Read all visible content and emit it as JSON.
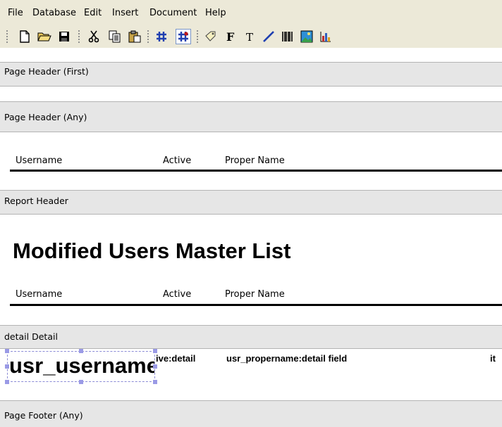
{
  "menu": {
    "items": [
      "File",
      "Database",
      "Edit",
      "Insert",
      "Document",
      "Help"
    ]
  },
  "toolbar": {
    "buttons": [
      {
        "name": "new-document-icon"
      },
      {
        "name": "open-folder-icon"
      },
      {
        "name": "save-icon"
      },
      {
        "name": "cut-icon"
      },
      {
        "name": "copy-icon"
      },
      {
        "name": "paste-icon"
      },
      {
        "name": "grid-icon"
      },
      {
        "name": "snap-to-grid-icon",
        "active": true
      },
      {
        "name": "label-tag-icon"
      },
      {
        "name": "field-icon"
      },
      {
        "name": "text-icon"
      },
      {
        "name": "line-icon"
      },
      {
        "name": "barcode-icon"
      },
      {
        "name": "image-icon"
      },
      {
        "name": "chart-icon"
      }
    ]
  },
  "bands": {
    "page_header_first": {
      "label": "Page Header (First)"
    },
    "page_header_any": {
      "label": "Page Header (Any)",
      "columns": [
        "Username",
        "Active",
        "Proper Name"
      ]
    },
    "report_header": {
      "label": "Report Header",
      "title": "Modified Users Master List",
      "columns": [
        "Username",
        "Active",
        "Proper Name"
      ]
    },
    "detail": {
      "label": "detail Detail",
      "selected_field": "usr_username",
      "fields": [
        "ive:detail",
        "usr_propername:detail field",
        "it"
      ]
    },
    "page_footer_any": {
      "label": "Page Footer (Any)"
    }
  },
  "colors": {
    "chrome": "#ece9d8",
    "band_header": "#e6e6e6",
    "selection": "#9a9ae6",
    "active_button_border": "#7a96c8"
  }
}
